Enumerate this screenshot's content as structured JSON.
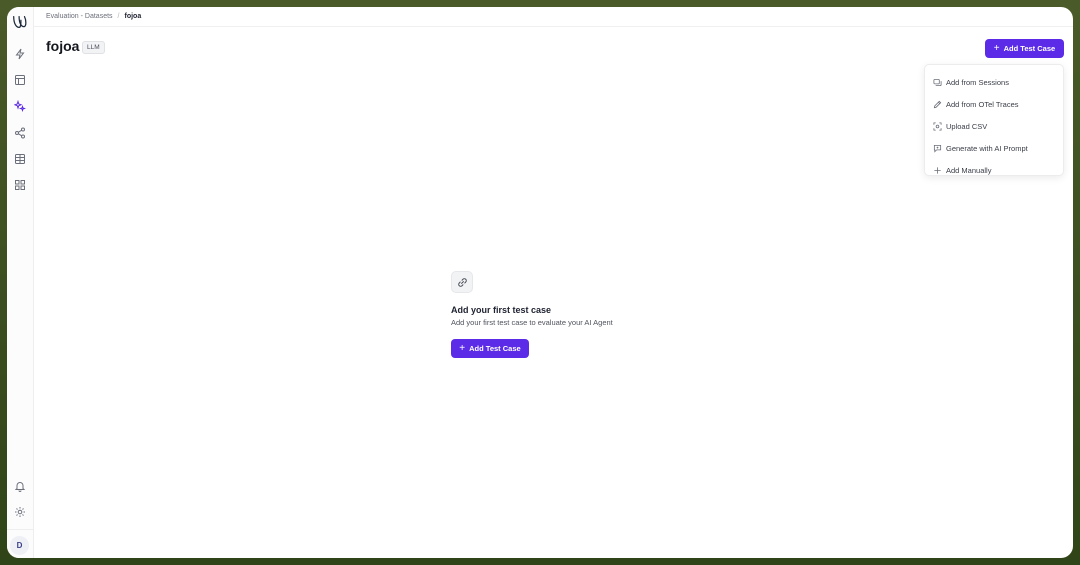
{
  "breadcrumb": {
    "parent": "Evaluation - Datasets",
    "separator": "/",
    "current": "fojoa"
  },
  "page": {
    "title": "fojoa",
    "badge": "LLM"
  },
  "header": {
    "add_button_label": "Add Test Case"
  },
  "menu": {
    "items": [
      {
        "label": "Add from Sessions",
        "icon": "sessions-icon"
      },
      {
        "label": "Add from OTel Traces",
        "icon": "pen-icon"
      },
      {
        "label": "Upload CSV",
        "icon": "scan-icon"
      },
      {
        "label": "Generate with AI Prompt",
        "icon": "chat-icon"
      },
      {
        "label": "Add Manually",
        "icon": "plus-icon"
      }
    ]
  },
  "empty_state": {
    "icon": "link-icon",
    "title": "Add your first test case",
    "subtitle": "Add your first test case to evaluate your AI Agent",
    "button_label": "Add Test Case"
  },
  "user": {
    "initial": "D"
  },
  "colors": {
    "accent": "#5b2be8",
    "active_nav": "#5b2be8",
    "background": "#3d4f20"
  }
}
